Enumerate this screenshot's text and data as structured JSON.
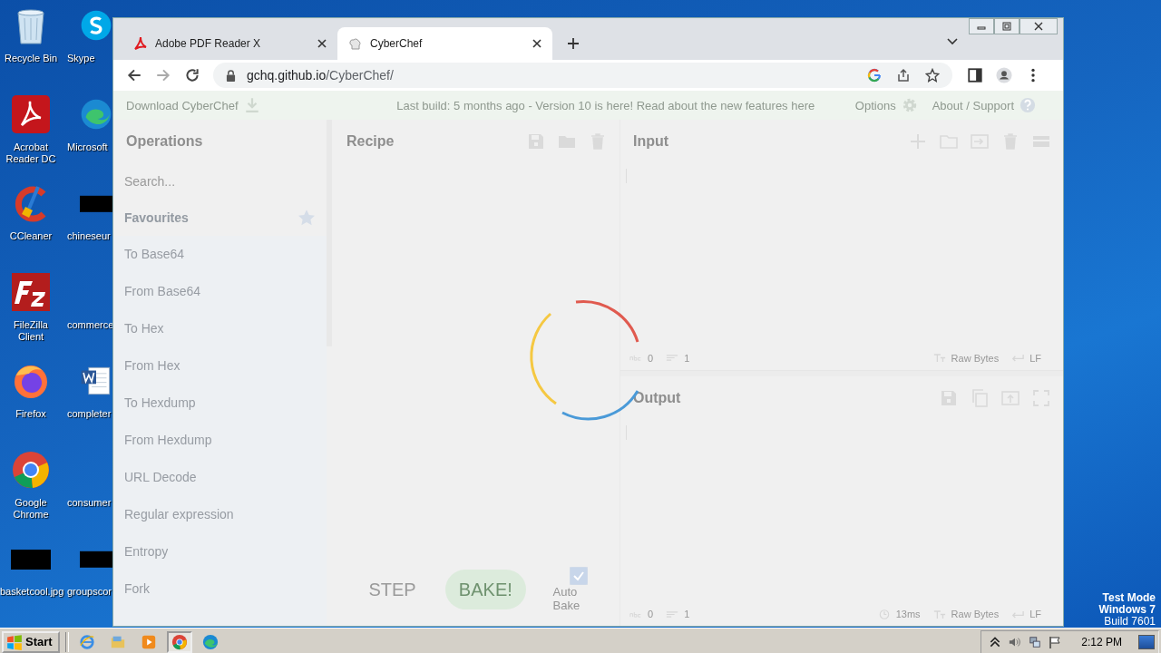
{
  "desktop": {
    "icons": [
      {
        "label": "Recycle Bin",
        "kind": "recycle"
      },
      {
        "label": "Acrobat Reader DC",
        "kind": "acrobat"
      },
      {
        "label": "CCleaner",
        "kind": "ccleaner"
      },
      {
        "label": "FileZilla Client",
        "kind": "filezilla"
      },
      {
        "label": "Firefox",
        "kind": "firefox"
      },
      {
        "label": "Google Chrome",
        "kind": "chrome"
      },
      {
        "label": "basketcool.jpg",
        "kind": "redacted"
      },
      {
        "label": "Skype",
        "kind": "skype"
      },
      {
        "label": "Microsoft",
        "kind": "edge"
      },
      {
        "label": "chineseur",
        "kind": "redacted"
      },
      {
        "label": "commerce",
        "kind": "blank"
      },
      {
        "label": "completer",
        "kind": "word"
      },
      {
        "label": "consumer",
        "kind": "blank"
      },
      {
        "label": "groupscor",
        "kind": "redacted"
      }
    ],
    "system_notice": [
      "Test Mode",
      "Windows 7",
      "Build 7601"
    ]
  },
  "browser": {
    "tabs": [
      {
        "title": "Adobe PDF Reader X",
        "kind": "pdf",
        "selected": false
      },
      {
        "title": "CyberChef",
        "kind": "chef",
        "selected": true
      }
    ],
    "address": {
      "host": "gchq.github.io",
      "path": "/CyberChef/"
    }
  },
  "cyberchef": {
    "loading": true,
    "banner": {
      "download": "Download CyberChef",
      "notice": "Last build: 5 months ago - Version 10 is here! Read about the new features here",
      "options": "Options",
      "about": "About / Support"
    },
    "operations": {
      "title": "Operations",
      "search_placeholder": "Search...",
      "category": "Favourites",
      "items": [
        "To Base64",
        "From Base64",
        "To Hex",
        "From Hex",
        "To Hexdump",
        "From Hexdump",
        "URL Decode",
        "Regular expression",
        "Entropy",
        "Fork"
      ]
    },
    "recipe": {
      "title": "Recipe",
      "step": "STEP",
      "bake": "BAKE!",
      "auto_bake": {
        "label": "Auto Bake",
        "checked": true
      }
    },
    "input": {
      "title": "Input",
      "length": "0",
      "lines": "1",
      "encoding": "Raw Bytes",
      "eol": "LF"
    },
    "output": {
      "title": "Output",
      "length": "0",
      "lines": "1",
      "time": "13ms",
      "encoding": "Raw Bytes",
      "eol": "LF"
    }
  },
  "taskbar": {
    "start": "Start",
    "apps": [
      {
        "kind": "ie",
        "selected": false
      },
      {
        "kind": "explorer",
        "selected": false
      },
      {
        "kind": "media",
        "selected": false
      },
      {
        "kind": "chrome",
        "selected": true
      },
      {
        "kind": "edge",
        "selected": false
      }
    ],
    "clock": "2:12 PM"
  }
}
